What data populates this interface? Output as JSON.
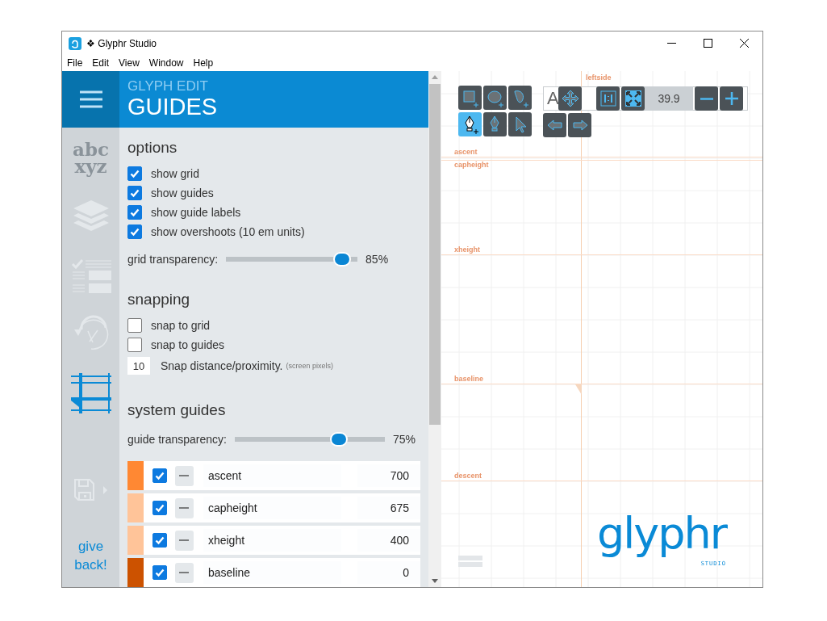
{
  "window": {
    "title": "❖ Glyphr Studio"
  },
  "menu": [
    {
      "label": "File"
    },
    {
      "label": "Edit"
    },
    {
      "label": "View"
    },
    {
      "label": "Window"
    },
    {
      "label": "Help"
    }
  ],
  "nav": {
    "items": [
      {
        "kind": "chooser",
        "selected": false,
        "lines": [
          "abc",
          "xyz"
        ]
      },
      {
        "kind": "layers",
        "selected": false
      },
      {
        "kind": "attributes",
        "selected": false
      },
      {
        "kind": "history",
        "selected": false
      },
      {
        "kind": "guides",
        "selected": true
      },
      {
        "kind": "save",
        "selected": false
      }
    ],
    "give_back": "give back!"
  },
  "panel": {
    "section": "GLYPH EDIT",
    "title": "GUIDES",
    "options": {
      "heading": "options",
      "checks": [
        {
          "label": "show grid",
          "checked": true
        },
        {
          "label": "show guides",
          "checked": true
        },
        {
          "label": "show guide labels",
          "checked": true
        },
        {
          "label": "show overshoots (10 em units)",
          "checked": true
        }
      ],
      "slider": {
        "label": "grid transparency:",
        "level": 0.94,
        "reading": "85%"
      }
    },
    "snapping": {
      "heading": "snapping",
      "checks": [
        {
          "label": "snap to grid",
          "checked": false
        },
        {
          "label": "snap to guides",
          "checked": false
        }
      ],
      "distance": {
        "value": "10",
        "label": "Snap distance/proximity.",
        "note": "(screen pixels)"
      }
    },
    "system_guides": {
      "heading": "system guides",
      "slider": {
        "label": "guide transparency:",
        "level": 0.72,
        "reading": "75%"
      },
      "guides": [
        {
          "name": "ascent",
          "value": "700",
          "visible": true,
          "color": "#ff8833"
        },
        {
          "name": "capheight",
          "value": "675",
          "visible": true,
          "color": "#ffc499"
        },
        {
          "name": "xheight",
          "value": "400",
          "visible": true,
          "color": "#ffc499"
        },
        {
          "name": "baseline",
          "value": "0",
          "visible": true,
          "color": "#cc5200"
        }
      ]
    }
  },
  "canvas": {
    "tools": [
      {
        "kind": "rectangle",
        "selected": false
      },
      {
        "kind": "oval",
        "selected": false
      },
      {
        "kind": "path",
        "selected": false
      },
      {
        "kind": "pen-plus",
        "selected": true
      },
      {
        "kind": "pen",
        "selected": false
      },
      {
        "kind": "pointer",
        "selected": false
      }
    ],
    "preview": "A",
    "zoom": "39.9",
    "guide_labels": [
      {
        "kind": "vertical",
        "label": "leftside"
      },
      {
        "kind": "horizontal",
        "label": "ascent"
      },
      {
        "kind": "horizontal",
        "label": "capheight"
      },
      {
        "kind": "horizontal",
        "label": "xheight"
      },
      {
        "kind": "horizontal",
        "label": "baseline"
      },
      {
        "kind": "horizontal",
        "label": "descent"
      }
    ],
    "logo": {
      "name": "glyphr",
      "sub": "STUDIO"
    }
  }
}
